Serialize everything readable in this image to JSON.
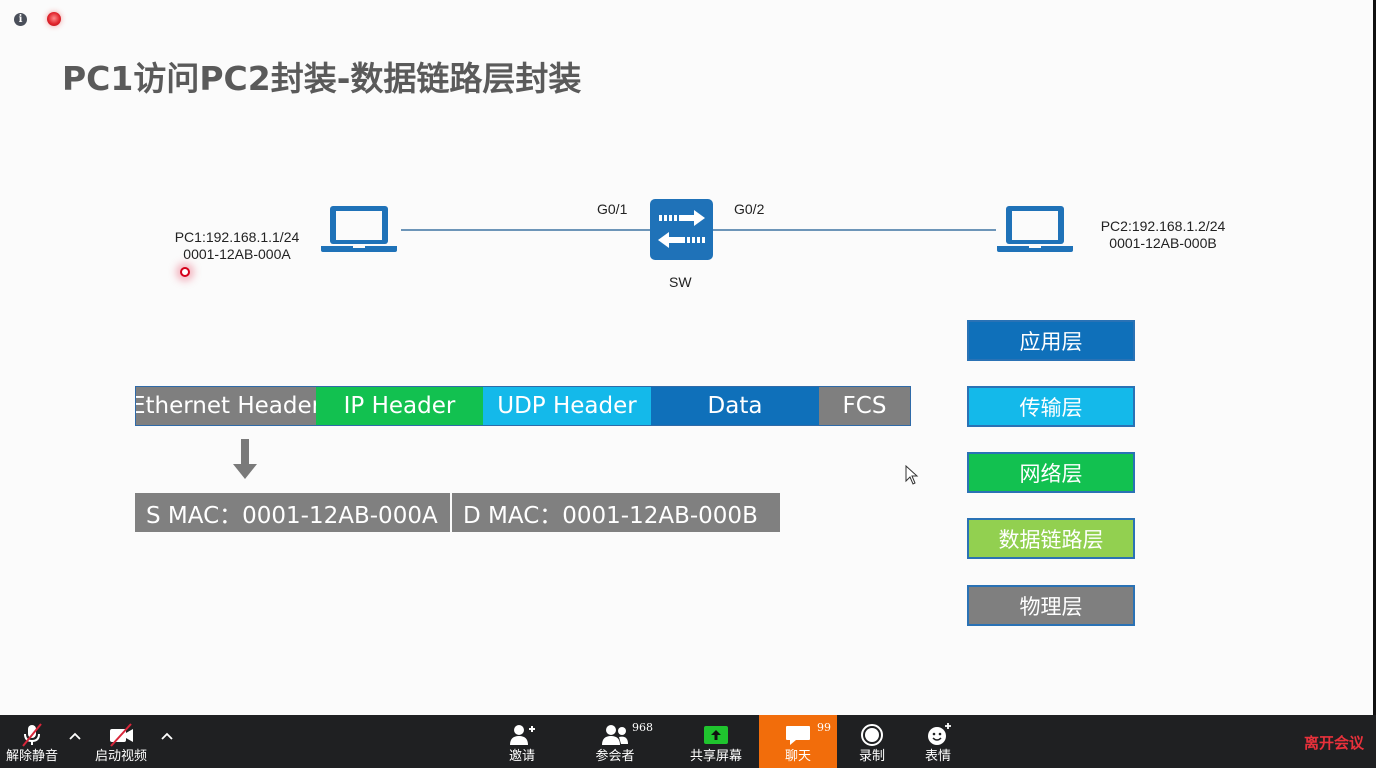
{
  "slide": {
    "title": "PC1访问PC2封装-数据链路层封装",
    "topology": {
      "pc1": {
        "ip": "PC1:192.168.1.1/24",
        "mac": "0001-12AB-000A",
        "icon": "laptop-icon"
      },
      "pc2": {
        "ip": "PC2:192.168.1.2/24",
        "mac": "0001-12AB-000B",
        "icon": "laptop-icon"
      },
      "switch": {
        "name": "SW",
        "port_left": "G0/1",
        "port_right": "G0/2",
        "icon": "switch-icon"
      }
    },
    "packet": {
      "segments": [
        {
          "label": "Ethernet Header",
          "color": "#7f7f7f"
        },
        {
          "label": "IP Header",
          "color": "#12c150"
        },
        {
          "label": "UDP Header",
          "color": "#14b9ea"
        },
        {
          "label": "Data",
          "color": "#0f70ba"
        },
        {
          "label": "FCS",
          "color": "#7f7f7f"
        }
      ]
    },
    "mac_fields": {
      "source": "S MAC：0001-12AB-000A",
      "destination": "D MAC：0001-12AB-000B"
    },
    "layers": [
      {
        "label": "应用层",
        "color": "#0f70ba"
      },
      {
        "label": "传输层",
        "color": "#14b9ea"
      },
      {
        "label": "网络层",
        "color": "#12c150"
      },
      {
        "label": "数据链路层",
        "color": "#92d050"
      },
      {
        "label": "物理层",
        "color": "#7f7f7f"
      }
    ]
  },
  "toolbar": {
    "unmute": "解除静音",
    "start_video": "启动视频",
    "invite": "邀请",
    "participants": "参会者",
    "participants_count": "968",
    "share_screen": "共享屏幕",
    "chat": "聊天",
    "chat_count": "99",
    "record": "录制",
    "reactions": "表情",
    "leave": "离开会议",
    "colors": {
      "chat_active": "#f26d0b",
      "leave": "#e8313b",
      "share": "#1fc42e"
    }
  }
}
